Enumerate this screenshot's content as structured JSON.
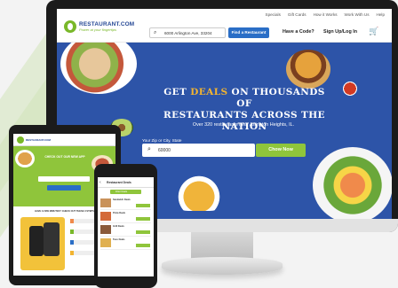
{
  "site": {
    "logo_name": "RESTAURANT.COM",
    "logo_tagline": "Power at your fingertips",
    "top_links": [
      "Specials",
      "Gift Cards",
      "How it Works",
      "Work With Us",
      "Help"
    ],
    "address_value": "6000 Arlington Ave, 33204",
    "find_button": "Find a Restaurant",
    "have_code": "Have a Code?",
    "signup": "Sign Up/Log In",
    "hero_line1_pre": "GET ",
    "hero_line1_deal": "DEALS",
    "hero_line1_post": " ON THOUSANDS OF",
    "hero_line2": "RESTAURANTS ACROSS THE NATION",
    "hero_sub": "Over 320 restaurants near Arlington Heights, IL.",
    "zip_label": "Your Zip or City, State",
    "zip_value": "60000",
    "chow_button": "Chow Now"
  },
  "tablet": {
    "headline": "CHECK OUT OUR NEW APP",
    "section": "HAVE A FEW MINUTES? CHECK OUT THESE 3 STEPS"
  },
  "phone": {
    "title": "Restaurant Deals",
    "filter": "Filter Deals",
    "rows": [
      "Sandwich Deals",
      "Pizza Deals",
      "Grill Deals",
      "Taco Deals"
    ]
  },
  "colors": {
    "brand_blue": "#2d54a8",
    "green": "#8fc53b",
    "accent": "#f2b430"
  }
}
